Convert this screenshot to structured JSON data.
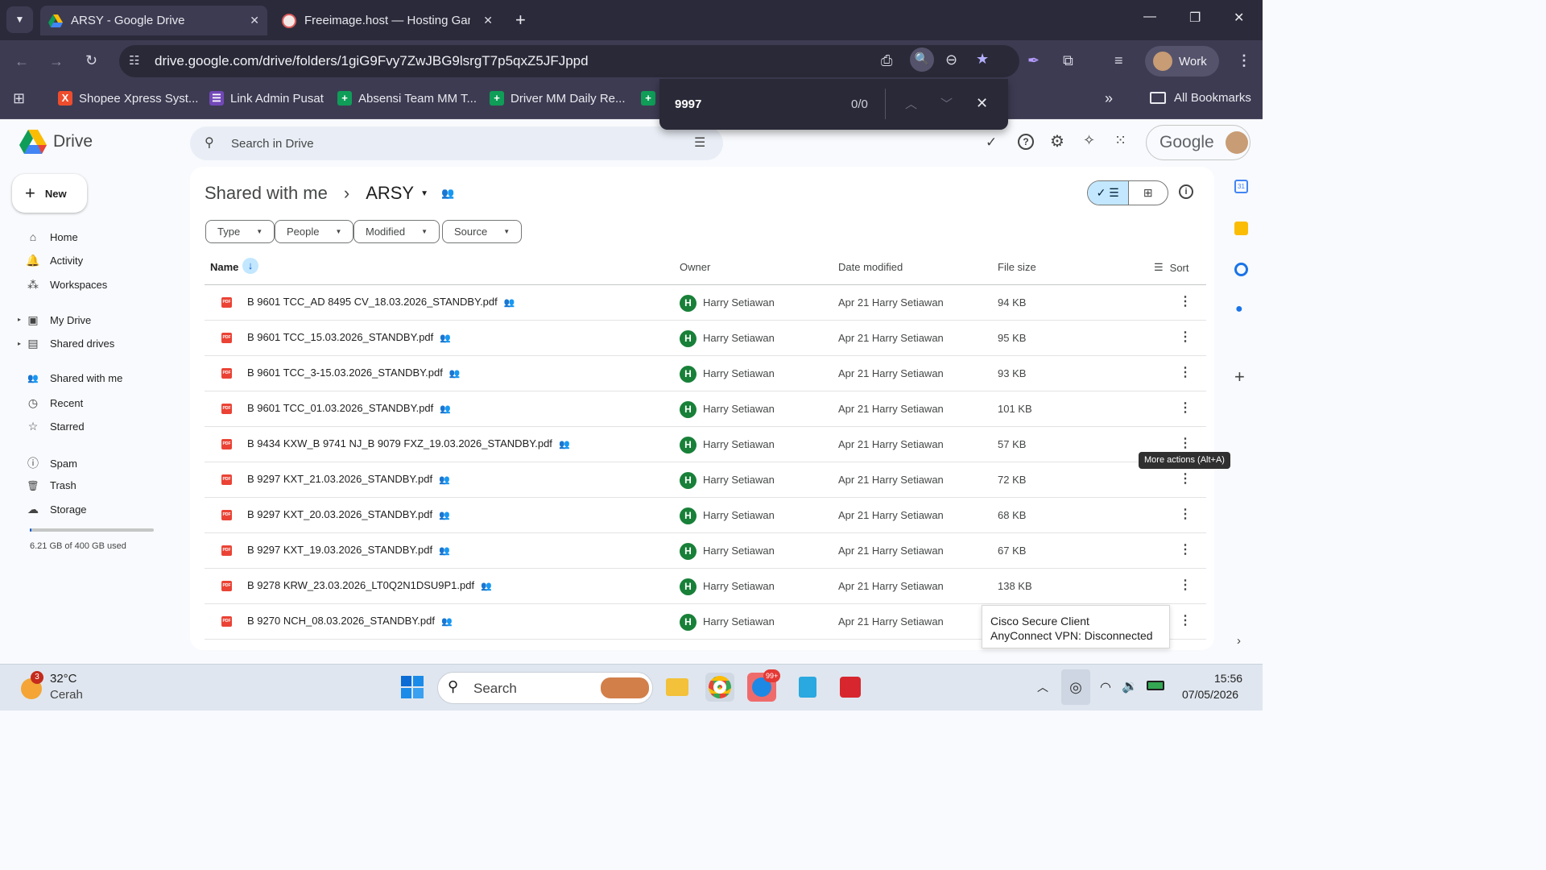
{
  "browser": {
    "tabs": [
      {
        "title": "ARSY - Google Drive",
        "active": true
      },
      {
        "title": "Freeimage.host — Hosting Gan",
        "active": false
      }
    ],
    "new_tab_symbol": "+",
    "url": "drive.google.com/drive/folders/1giG9Fvy7ZwJBG9lsrgT7p5qxZ5JFJppd",
    "profile_label": "Work",
    "bookmarks": [
      {
        "label": "Shopee Xpress Syst...",
        "icon": "shopee-icon",
        "color": "#ee4d2d"
      },
      {
        "label": "Link Admin Pusat",
        "icon": "forms-icon",
        "color": "#7248b9"
      },
      {
        "label": "Absensi Team MM T...",
        "icon": "sheets-icon",
        "color": "#0f9d58"
      },
      {
        "label": "Driver MM Daily Re...",
        "icon": "sheets-icon",
        "color": "#0f9d58"
      }
    ],
    "overflow_symbol": "»",
    "all_bookmarks_label": "All Bookmarks"
  },
  "findbar": {
    "query": "9997",
    "count": "0/0"
  },
  "drive": {
    "logo_label": "Drive",
    "search_placeholder": "Search in Drive",
    "new_button_label": "New",
    "account_label": "Google",
    "nav": [
      {
        "label": "Home",
        "icon": "home-icon",
        "glyph": "⌂"
      },
      {
        "label": "Activity",
        "icon": "bell-icon",
        "glyph": "🔔"
      },
      {
        "label": "Workspaces",
        "icon": "workspaces-icon",
        "glyph": "⁂"
      },
      {
        "label": "My Drive",
        "icon": "my-drive-icon",
        "glyph": "▣"
      },
      {
        "label": "Shared drives",
        "icon": "shared-drives-icon",
        "glyph": "▤"
      },
      {
        "label": "Shared with me",
        "icon": "people-icon",
        "glyph": "👥"
      },
      {
        "label": "Recent",
        "icon": "clock-icon",
        "glyph": "◷"
      },
      {
        "label": "Starred",
        "icon": "star-icon",
        "glyph": "☆"
      },
      {
        "label": "Spam",
        "icon": "spam-icon",
        "glyph": "ⓘ"
      },
      {
        "label": "Trash",
        "icon": "trash-icon",
        "glyph": "🗑"
      },
      {
        "label": "Storage",
        "icon": "cloud-icon",
        "glyph": "☁"
      }
    ],
    "storage_text": "6.21 GB of 400 GB used",
    "storage_used_fraction": 0.0155,
    "breadcrumb": {
      "root": "Shared with me",
      "separator": "›",
      "current": "ARSY"
    },
    "filters": [
      "Type",
      "People",
      "Modified",
      "Source"
    ],
    "columns": {
      "name": "Name",
      "owner": "Owner",
      "date_modified": "Date modified",
      "file_size": "File size",
      "sort": "Sort"
    },
    "files": [
      {
        "name": "B 9601 TCC_AD 8495 CV_18.03.2026_STANDBY.pdf",
        "owner_initial": "H",
        "owner": "Harry Setiawan",
        "modified": "Apr 21 Harry Setiawan",
        "size": "94 KB"
      },
      {
        "name": "B 9601 TCC_15.03.2026_STANDBY.pdf",
        "owner_initial": "H",
        "owner": "Harry Setiawan",
        "modified": "Apr 21 Harry Setiawan",
        "size": "95 KB"
      },
      {
        "name": "B 9601 TCC_3-15.03.2026_STANDBY.pdf",
        "owner_initial": "H",
        "owner": "Harry Setiawan",
        "modified": "Apr 21 Harry Setiawan",
        "size": "93 KB"
      },
      {
        "name": "B 9601 TCC_01.03.2026_STANDBY.pdf",
        "owner_initial": "H",
        "owner": "Harry Setiawan",
        "modified": "Apr 21 Harry Setiawan",
        "size": "101 KB"
      },
      {
        "name": "B 9434 KXW_B 9741 NJ_B 9079 FXZ_19.03.2026_STANDBY.pdf",
        "owner_initial": "H",
        "owner": "Harry Setiawan",
        "modified": "Apr 21 Harry Setiawan",
        "size": "57 KB"
      },
      {
        "name": "B 9297 KXT_21.03.2026_STANDBY.pdf",
        "owner_initial": "H",
        "owner": "Harry Setiawan",
        "modified": "Apr 21 Harry Setiawan",
        "size": "72 KB"
      },
      {
        "name": "B 9297 KXT_20.03.2026_STANDBY.pdf",
        "owner_initial": "H",
        "owner": "Harry Setiawan",
        "modified": "Apr 21 Harry Setiawan",
        "size": "68 KB"
      },
      {
        "name": "B 9297 KXT_19.03.2026_STANDBY.pdf",
        "owner_initial": "H",
        "owner": "Harry Setiawan",
        "modified": "Apr 21 Harry Setiawan",
        "size": "67 KB"
      },
      {
        "name": "B 9278 KRW_23.03.2026_LT0Q2N1DSU9P1.pdf",
        "owner_initial": "H",
        "owner": "Harry Setiawan",
        "modified": "Apr 21 Harry Setiawan",
        "size": "138 KB"
      },
      {
        "name": "B 9270 NCH_08.03.2026_STANDBY.pdf",
        "owner_initial": "H",
        "owner": "Harry Setiawan",
        "modified": "Apr 21 Harry Setiawan",
        "size": ""
      }
    ],
    "tooltip": "More actions (Alt+A)"
  },
  "vpn_popup": {
    "line1": "Cisco Secure Client",
    "line2": "AnyConnect VPN: Disconnected"
  },
  "taskbar": {
    "weather_badge": "3",
    "temperature": "32°C",
    "condition": "Cerah",
    "search_label": "Search",
    "chat_badge": "99+",
    "time": "15:56",
    "date": "07/05/2026"
  }
}
